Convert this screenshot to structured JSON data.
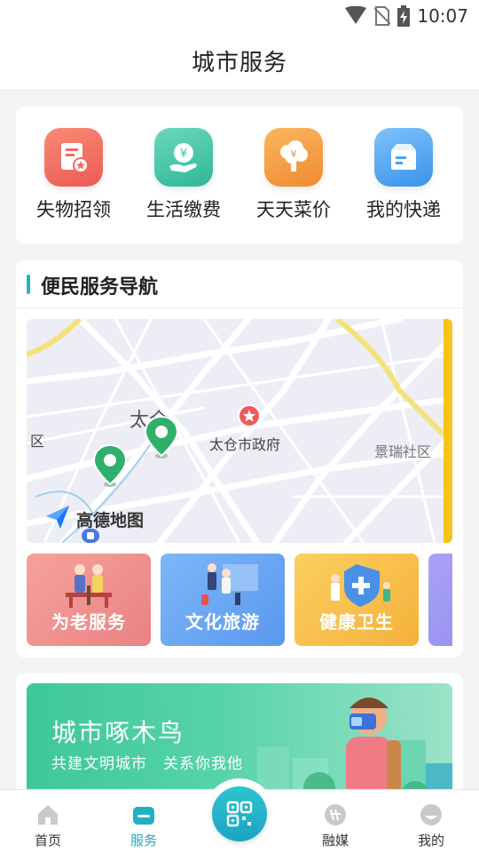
{
  "status_bar": {
    "time": "10:07"
  },
  "header": {
    "title": "城市服务"
  },
  "quick_services": [
    {
      "label": "失物招领",
      "icon": "lost-found-icon",
      "color": "#f2695a"
    },
    {
      "label": "生活缴费",
      "icon": "bill-payment-icon",
      "color": "#3cc3a5"
    },
    {
      "label": "天天菜价",
      "icon": "vegetable-price-icon",
      "color": "#f59a42"
    },
    {
      "label": "我的快递",
      "icon": "package-icon",
      "color": "#4aa3ee"
    }
  ],
  "nav": {
    "title": "便民服务导航",
    "map": {
      "labels": {
        "town": "太仓",
        "government": "太仓市政府",
        "community": "景瑞社区",
        "district_partial": "区"
      },
      "provider": "高德地图"
    },
    "tiles": [
      {
        "label": "为老服务",
        "color": "#f08b8b"
      },
      {
        "label": "文化旅游",
        "color": "#6aa8f3"
      },
      {
        "label": "健康卫生",
        "color": "#f8bd4d"
      },
      {
        "label": "",
        "color": "#9a93ef"
      }
    ]
  },
  "banner": {
    "title": "城市啄木鸟",
    "subtitle": "共建文明城市　关系你我他"
  },
  "tabbar": {
    "tabs": [
      {
        "label": "首页",
        "icon": "home-icon"
      },
      {
        "label": "服务",
        "icon": "service-icon"
      },
      {
        "label": "融媒",
        "icon": "media-icon"
      },
      {
        "label": "我的",
        "icon": "profile-icon"
      }
    ],
    "active": "服务",
    "center_icon": "scan-icon"
  },
  "colors": {
    "accent": "#22b6b8",
    "tab_active": "#20a8c0"
  }
}
